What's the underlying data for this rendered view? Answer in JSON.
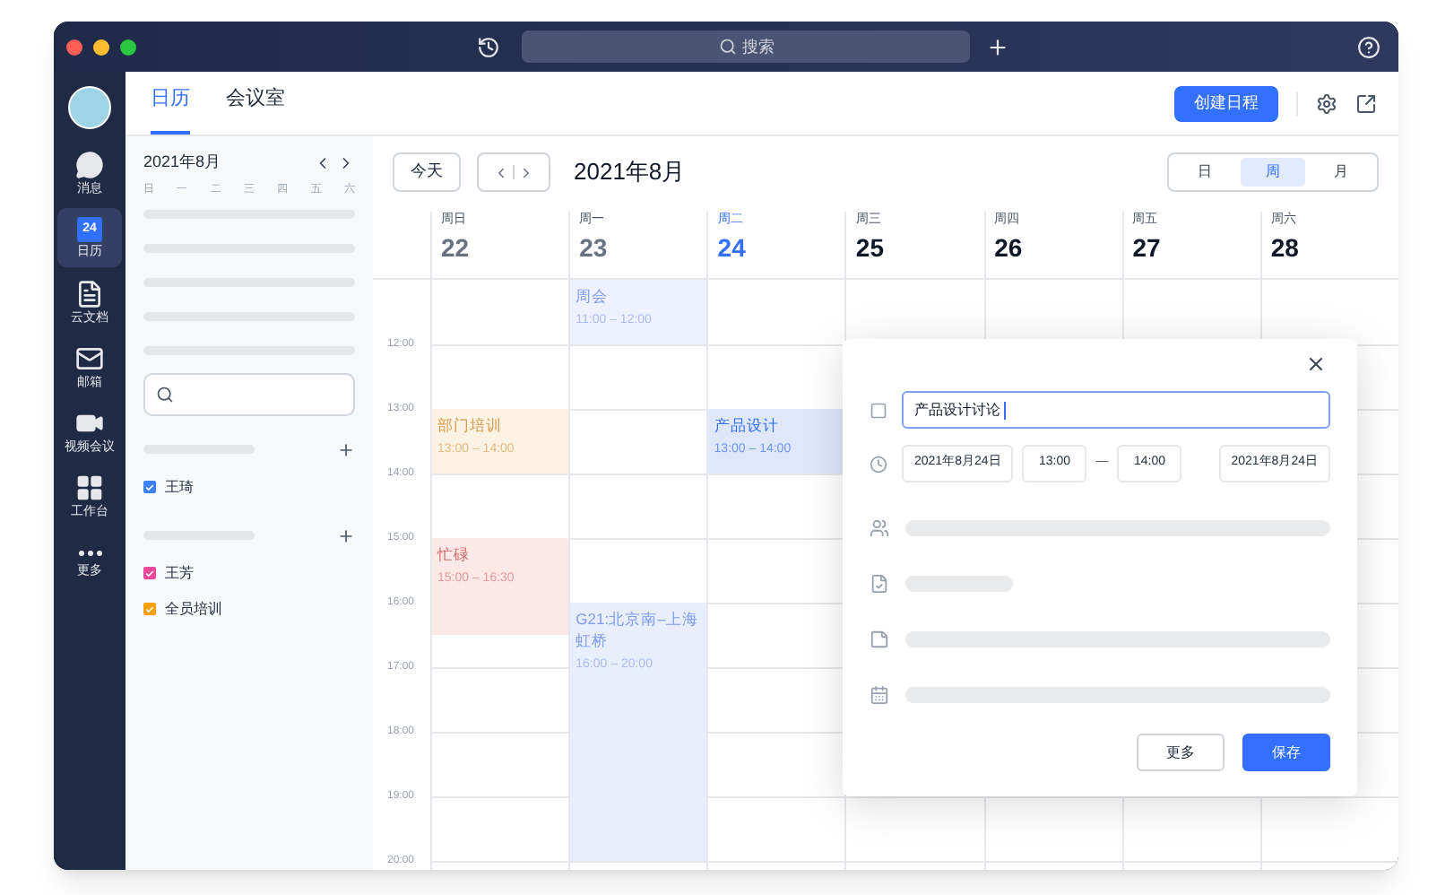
{
  "titlebar": {
    "search": {
      "placeholder": "搜索"
    }
  },
  "rail": {
    "items": [
      {
        "label": "消息",
        "selected": false
      },
      {
        "label": "日历",
        "selected": true,
        "badge": "24"
      },
      {
        "label": "云文档",
        "selected": false
      },
      {
        "label": "邮箱",
        "selected": false
      },
      {
        "label": "视频会议",
        "selected": false
      },
      {
        "label": "工作台",
        "selected": false
      },
      {
        "label": "更多",
        "selected": false
      }
    ]
  },
  "tabs": [
    {
      "label": "日历",
      "selected": true
    },
    {
      "label": "会议室",
      "selected": false
    }
  ],
  "create_button": "创建日程",
  "mini_calendar": {
    "month": "2021年8月",
    "weekdays": [
      "日",
      "一",
      "二",
      "三",
      "四",
      "五",
      "六"
    ]
  },
  "calendar_groups": [
    {
      "items": [
        {
          "label": "王琦",
          "checked": true,
          "color": "#3b82f6"
        }
      ]
    },
    {
      "items": [
        {
          "label": "王芳",
          "checked": true,
          "color": "#ec4899"
        },
        {
          "label": "全员培训",
          "checked": true,
          "color": "#f59e0b"
        }
      ]
    }
  ],
  "toolbar": {
    "today": "今天",
    "title": "2021年8月",
    "views": [
      {
        "label": "日",
        "selected": false
      },
      {
        "label": "周",
        "selected": true
      },
      {
        "label": "月",
        "selected": false
      }
    ]
  },
  "days": [
    {
      "weekday": "周日",
      "date": "22",
      "today": false,
      "past": true,
      "events": [
        {
          "title": "部门培训",
          "time": "13:00 – 14:00",
          "kind": "orange",
          "color": "#fdf3e4"
        },
        {
          "title": "忙碌",
          "time": "15:00 – 16:30",
          "kind": "red",
          "color": "#fde8e8"
        }
      ]
    },
    {
      "weekday": "周一",
      "date": "23",
      "today": false,
      "past": true,
      "events": [
        {
          "title": "周会",
          "time": "11:00 – 12:00",
          "kind": "light",
          "color": "#eef2ff"
        },
        {
          "title": "G21:北京南–上海虹桥",
          "time": "16:00 – 20:00",
          "kind": "light",
          "color": "#e8eefc"
        }
      ]
    },
    {
      "weekday": "周二",
      "date": "24",
      "today": true,
      "past": false,
      "events": [
        {
          "title": "产品设计",
          "time": "13:00 – 14:00",
          "kind": "active",
          "color": "#dfe7fb"
        }
      ]
    },
    {
      "weekday": "周三",
      "date": "25",
      "today": false,
      "past": false
    },
    {
      "weekday": "周四",
      "date": "26",
      "today": false,
      "past": false
    },
    {
      "weekday": "周五",
      "date": "27",
      "today": false,
      "past": false
    },
    {
      "weekday": "周六",
      "date": "28",
      "today": false,
      "past": false
    }
  ],
  "hours": [
    "12:00",
    "13:00",
    "14:00",
    "15:00",
    "16:00",
    "17:00",
    "18:00",
    "19:00",
    "20:00"
  ],
  "popup": {
    "title_value": "产品设计讨论",
    "start_date": "2021年8月24日",
    "start_time": "13:00",
    "separator": "—",
    "end_time": "14:00",
    "end_date": "2021年8月24日",
    "more": "更多",
    "save": "保存"
  }
}
